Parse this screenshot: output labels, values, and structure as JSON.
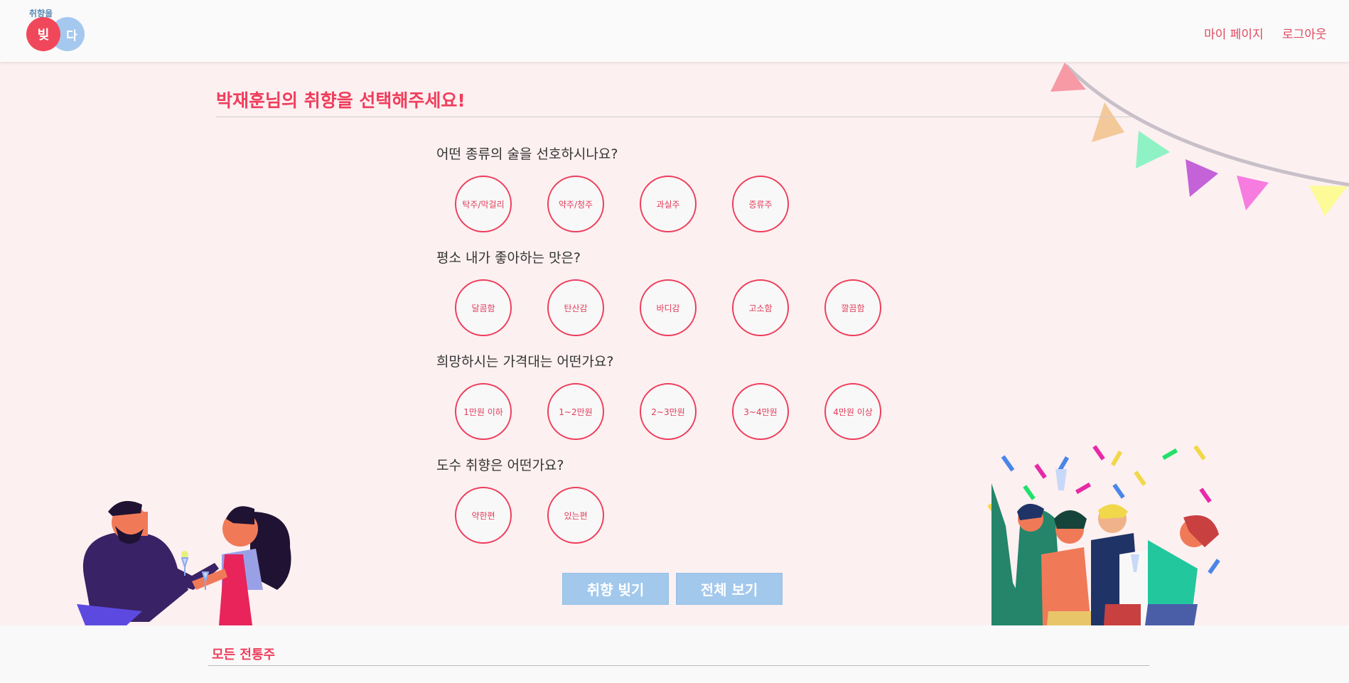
{
  "header": {
    "logo_top": "취향을",
    "logo_left": "빚",
    "logo_right": "다",
    "nav": [
      "마이 페이지",
      "로그아웃"
    ]
  },
  "main": {
    "title": "박재훈님의 취향을 선택해주세요!"
  },
  "questions": [
    {
      "text": "어떤 종류의 술을 선호하시나요?",
      "options": [
        "탁주/막걸리",
        "약주/청주",
        "과실주",
        "증류주"
      ]
    },
    {
      "text": "평소 내가 좋아하는 맛은?",
      "options": [
        "달콤함",
        "탄산감",
        "바디감",
        "고소함",
        "깔끔함"
      ]
    },
    {
      "text": "희망하시는 가격대는 어떤가요?",
      "options": [
        "1만원 이하",
        "1~2만원",
        "2~3만원",
        "3~4만원",
        "4만원 이상"
      ]
    },
    {
      "text": "도수 취향은 어떤가요?",
      "options": [
        "약한편",
        "있는편"
      ]
    }
  ],
  "buttons": {
    "make": "취향 빚기",
    "view_all": "전체 보기"
  },
  "footer": {
    "title": "모든 전통주"
  },
  "colors": {
    "accent": "#ef3e5c",
    "button": "#a2c8ec",
    "background": "#fdf0f1"
  },
  "icons": [
    "bunting-flags-illustration",
    "couple-toasting-illustration",
    "party-crowd-illustration"
  ]
}
